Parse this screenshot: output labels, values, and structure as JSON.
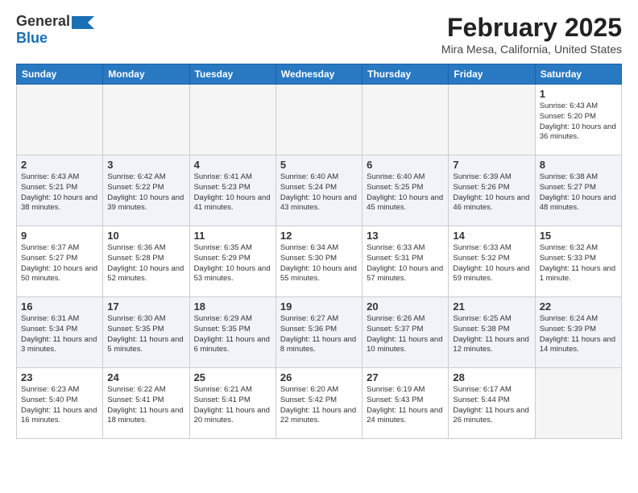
{
  "header": {
    "logo_general": "General",
    "logo_blue": "Blue",
    "month_title": "February 2025",
    "location": "Mira Mesa, California, United States"
  },
  "weekdays": [
    "Sunday",
    "Monday",
    "Tuesday",
    "Wednesday",
    "Thursday",
    "Friday",
    "Saturday"
  ],
  "weeks": [
    [
      {
        "day": "",
        "info": ""
      },
      {
        "day": "",
        "info": ""
      },
      {
        "day": "",
        "info": ""
      },
      {
        "day": "",
        "info": ""
      },
      {
        "day": "",
        "info": ""
      },
      {
        "day": "",
        "info": ""
      },
      {
        "day": "1",
        "info": "Sunrise: 6:43 AM\nSunset: 5:20 PM\nDaylight: 10 hours and 36 minutes."
      }
    ],
    [
      {
        "day": "2",
        "info": "Sunrise: 6:43 AM\nSunset: 5:21 PM\nDaylight: 10 hours and 38 minutes."
      },
      {
        "day": "3",
        "info": "Sunrise: 6:42 AM\nSunset: 5:22 PM\nDaylight: 10 hours and 39 minutes."
      },
      {
        "day": "4",
        "info": "Sunrise: 6:41 AM\nSunset: 5:23 PM\nDaylight: 10 hours and 41 minutes."
      },
      {
        "day": "5",
        "info": "Sunrise: 6:40 AM\nSunset: 5:24 PM\nDaylight: 10 hours and 43 minutes."
      },
      {
        "day": "6",
        "info": "Sunrise: 6:40 AM\nSunset: 5:25 PM\nDaylight: 10 hours and 45 minutes."
      },
      {
        "day": "7",
        "info": "Sunrise: 6:39 AM\nSunset: 5:26 PM\nDaylight: 10 hours and 46 minutes."
      },
      {
        "day": "8",
        "info": "Sunrise: 6:38 AM\nSunset: 5:27 PM\nDaylight: 10 hours and 48 minutes."
      }
    ],
    [
      {
        "day": "9",
        "info": "Sunrise: 6:37 AM\nSunset: 5:27 PM\nDaylight: 10 hours and 50 minutes."
      },
      {
        "day": "10",
        "info": "Sunrise: 6:36 AM\nSunset: 5:28 PM\nDaylight: 10 hours and 52 minutes."
      },
      {
        "day": "11",
        "info": "Sunrise: 6:35 AM\nSunset: 5:29 PM\nDaylight: 10 hours and 53 minutes."
      },
      {
        "day": "12",
        "info": "Sunrise: 6:34 AM\nSunset: 5:30 PM\nDaylight: 10 hours and 55 minutes."
      },
      {
        "day": "13",
        "info": "Sunrise: 6:33 AM\nSunset: 5:31 PM\nDaylight: 10 hours and 57 minutes."
      },
      {
        "day": "14",
        "info": "Sunrise: 6:33 AM\nSunset: 5:32 PM\nDaylight: 10 hours and 59 minutes."
      },
      {
        "day": "15",
        "info": "Sunrise: 6:32 AM\nSunset: 5:33 PM\nDaylight: 11 hours and 1 minute."
      }
    ],
    [
      {
        "day": "16",
        "info": "Sunrise: 6:31 AM\nSunset: 5:34 PM\nDaylight: 11 hours and 3 minutes."
      },
      {
        "day": "17",
        "info": "Sunrise: 6:30 AM\nSunset: 5:35 PM\nDaylight: 11 hours and 5 minutes."
      },
      {
        "day": "18",
        "info": "Sunrise: 6:29 AM\nSunset: 5:35 PM\nDaylight: 11 hours and 6 minutes."
      },
      {
        "day": "19",
        "info": "Sunrise: 6:27 AM\nSunset: 5:36 PM\nDaylight: 11 hours and 8 minutes."
      },
      {
        "day": "20",
        "info": "Sunrise: 6:26 AM\nSunset: 5:37 PM\nDaylight: 11 hours and 10 minutes."
      },
      {
        "day": "21",
        "info": "Sunrise: 6:25 AM\nSunset: 5:38 PM\nDaylight: 11 hours and 12 minutes."
      },
      {
        "day": "22",
        "info": "Sunrise: 6:24 AM\nSunset: 5:39 PM\nDaylight: 11 hours and 14 minutes."
      }
    ],
    [
      {
        "day": "23",
        "info": "Sunrise: 6:23 AM\nSunset: 5:40 PM\nDaylight: 11 hours and 16 minutes."
      },
      {
        "day": "24",
        "info": "Sunrise: 6:22 AM\nSunset: 5:41 PM\nDaylight: 11 hours and 18 minutes."
      },
      {
        "day": "25",
        "info": "Sunrise: 6:21 AM\nSunset: 5:41 PM\nDaylight: 11 hours and 20 minutes."
      },
      {
        "day": "26",
        "info": "Sunrise: 6:20 AM\nSunset: 5:42 PM\nDaylight: 11 hours and 22 minutes."
      },
      {
        "day": "27",
        "info": "Sunrise: 6:19 AM\nSunset: 5:43 PM\nDaylight: 11 hours and 24 minutes."
      },
      {
        "day": "28",
        "info": "Sunrise: 6:17 AM\nSunset: 5:44 PM\nDaylight: 11 hours and 26 minutes."
      },
      {
        "day": "",
        "info": ""
      }
    ]
  ]
}
